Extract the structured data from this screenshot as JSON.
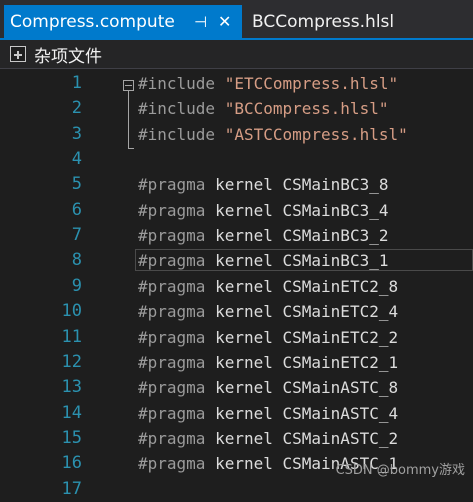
{
  "tabs": [
    {
      "label": "Compress.compute",
      "pin_glyph": "⊣",
      "close_glyph": "✕"
    },
    {
      "label": "BCCompress.hlsl"
    }
  ],
  "navbar": {
    "icon": "project-icon",
    "label": "杂项文件"
  },
  "lines": [
    {
      "num": "1",
      "kw": "#include",
      "rest": "\"ETCCompress.hlsl\"",
      "type": "include"
    },
    {
      "num": "2",
      "kw": "#include",
      "rest": "\"BCCompress.hlsl\"",
      "type": "include"
    },
    {
      "num": "3",
      "kw": "#include",
      "rest": "\"ASTCCompress.hlsl\"",
      "type": "include"
    },
    {
      "num": "4",
      "kw": "",
      "rest": "",
      "type": "empty"
    },
    {
      "num": "5",
      "kw": "#pragma",
      "rest": "kernel CSMainBC3_8",
      "type": "pragma"
    },
    {
      "num": "6",
      "kw": "#pragma",
      "rest": "kernel CSMainBC3_4",
      "type": "pragma"
    },
    {
      "num": "7",
      "kw": "#pragma",
      "rest": "kernel CSMainBC3_2",
      "type": "pragma"
    },
    {
      "num": "8",
      "kw": "#pragma",
      "rest": "kernel CSMainBC3_1",
      "type": "pragma"
    },
    {
      "num": "9",
      "kw": "#pragma",
      "rest": "kernel CSMainETC2_8",
      "type": "pragma"
    },
    {
      "num": "10",
      "kw": "#pragma",
      "rest": "kernel CSMainETC2_4",
      "type": "pragma"
    },
    {
      "num": "11",
      "kw": "#pragma",
      "rest": "kernel CSMainETC2_2",
      "type": "pragma"
    },
    {
      "num": "12",
      "kw": "#pragma",
      "rest": "kernel CSMainETC2_1",
      "type": "pragma"
    },
    {
      "num": "13",
      "kw": "#pragma",
      "rest": "kernel CSMainASTC_8",
      "type": "pragma"
    },
    {
      "num": "14",
      "kw": "#pragma",
      "rest": "kernel CSMainASTC_4",
      "type": "pragma"
    },
    {
      "num": "15",
      "kw": "#pragma",
      "rest": "kernel CSMainASTC_2",
      "type": "pragma"
    },
    {
      "num": "16",
      "kw": "#pragma",
      "rest": "kernel CSMainASTC_1",
      "type": "pragma"
    },
    {
      "num": "17",
      "kw": "",
      "rest": "",
      "type": "empty"
    }
  ],
  "current_line": "8",
  "watermark": "CSDN @bommy游戏",
  "colors": {
    "accent": "#007acc",
    "line_number": "#2b91af",
    "preprocessor": "#9b9b9b",
    "string": "#d69d85",
    "text": "#dcdcdc",
    "background": "#1e1e1e"
  }
}
